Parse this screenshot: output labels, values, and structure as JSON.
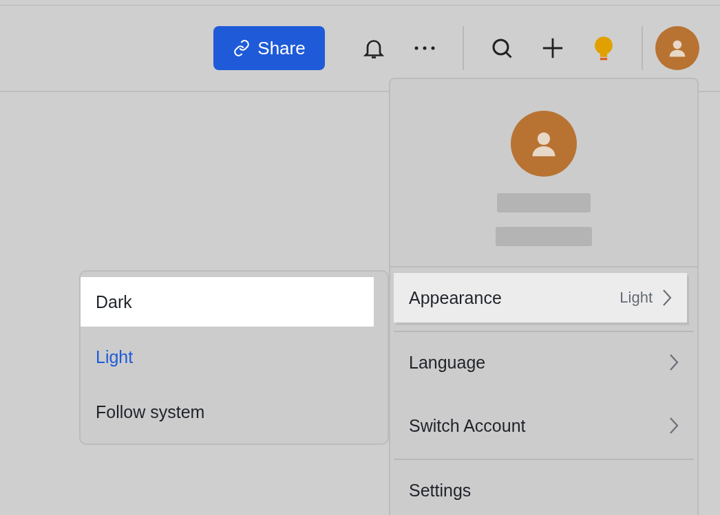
{
  "toolbar": {
    "share_button": "Share"
  },
  "account_menu": {
    "groups": [
      [
        {
          "label": "Appearance",
          "value": "Light",
          "submenu": true,
          "highlighted": true
        }
      ],
      [
        {
          "label": "Language",
          "submenu": true,
          "highlighted": false
        },
        {
          "label": "Switch Account",
          "submenu": true,
          "highlighted": false
        }
      ],
      [
        {
          "label": "Settings",
          "submenu": false,
          "highlighted": false
        }
      ]
    ]
  },
  "appearance_submenu": {
    "options": [
      {
        "label": "Dark",
        "selected": false,
        "highlighted": true
      },
      {
        "label": "Light",
        "selected": true,
        "highlighted": false
      },
      {
        "label": "Follow system",
        "selected": false,
        "highlighted": false
      }
    ]
  }
}
